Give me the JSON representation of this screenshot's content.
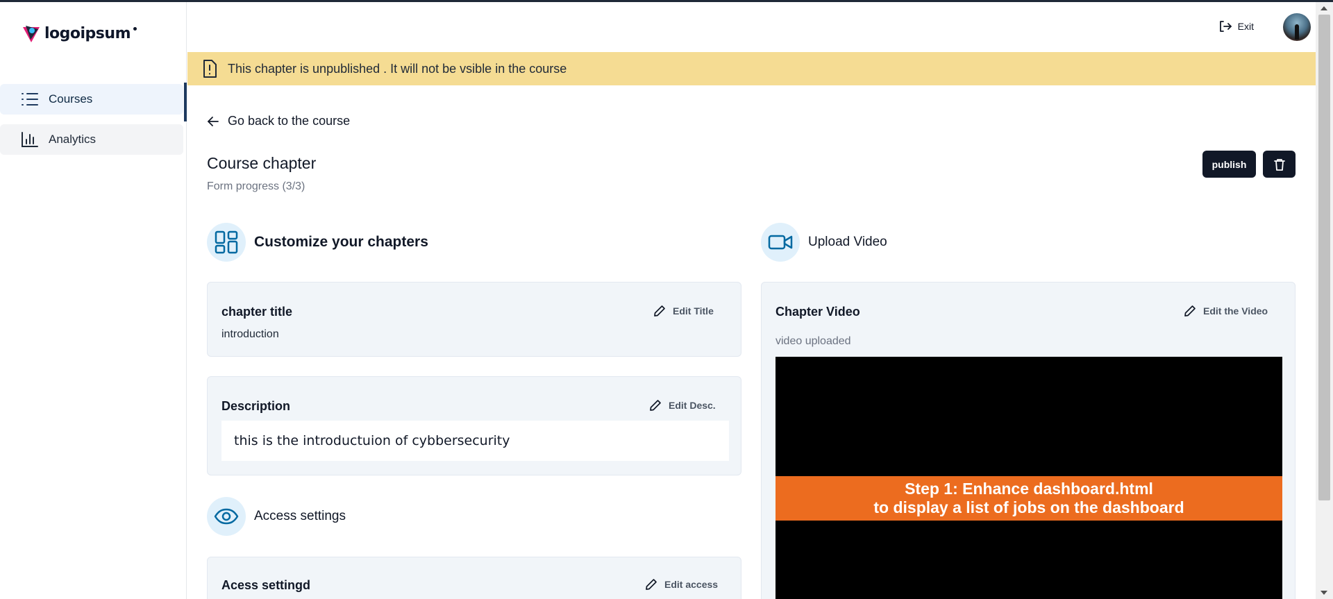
{
  "app": {
    "logo_text": "logoipsum",
    "accent": "#1e3a5f",
    "banner_color": "#f5dc93"
  },
  "sidebar": {
    "items": [
      {
        "label": "Courses",
        "icon": "list-icon",
        "active": true
      },
      {
        "label": "Analytics",
        "icon": "bar-chart-icon",
        "active": false
      }
    ]
  },
  "header": {
    "exit_label": "Exit",
    "exit_icon": "log-out-icon"
  },
  "banner": {
    "text": "This chapter is unpublished . It will not be vsible in the course",
    "icon": "alert-file-icon"
  },
  "page": {
    "back_label": "Go back to the course",
    "title": "Course chapter",
    "progress": "Form progress (3/3)",
    "publish_label": "publish",
    "delete_icon": "trash-icon"
  },
  "customize": {
    "title": "Customize your chapters",
    "icon": "layout-dashboard-icon",
    "chapter_title": {
      "label": "chapter title",
      "value": "introduction",
      "edit_label": "Edit Title"
    },
    "description": {
      "label": "Description",
      "value": "this is the introductuion of cybbersecurity",
      "edit_label": "Edit Desc."
    }
  },
  "access": {
    "title": "Access settings",
    "icon": "eye-icon",
    "card_label": "Acess settingd",
    "edit_label": "Edit access"
  },
  "video": {
    "title": "Upload Video",
    "icon": "video-camera-icon",
    "card_label": "Chapter Video",
    "edit_label": "Edit the Video",
    "status": "video uploaded",
    "caption_line1": "Step 1: Enhance dashboard.html",
    "caption_line2": "to display a list of jobs on the dashboard"
  }
}
